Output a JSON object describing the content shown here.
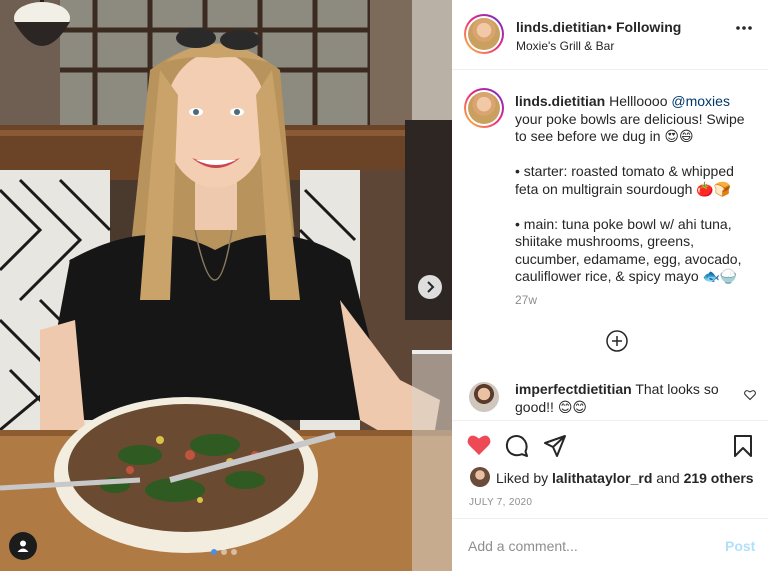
{
  "post": {
    "username": "linds.dietitian",
    "separator": "•",
    "follow_state": "Following",
    "location": "Moxie's Grill & Bar",
    "more_icon": "more-horizontal-icon"
  },
  "caption": {
    "username": "linds.dietitian",
    "intro_before_mention": "Hellloooo ",
    "mention": "@moxies",
    "intro_after_mention": " your poke bowls are delicious! Swipe to see before we dug in 😍😄",
    "starter": "• starter: roasted tomato & whipped feta on multigrain sourdough 🍅🍞",
    "main": "• main: tuna poke bowl w/ ahi tuna, shiitake mushrooms, greens, cucumber, edamame, egg, avocado, cauliflower rice, & spicy mayo 🐟🍚",
    "time_ago": "27w"
  },
  "comments": [
    {
      "username": "imperfectdietitian",
      "text": "That looks so good!! 😊😊"
    }
  ],
  "actions": {
    "liked_by_prefix": "Liked by ",
    "liked_by_user": "lalithataylor_rd",
    "liked_and": " and ",
    "others": "219 others",
    "date": "JULY 7, 2020",
    "heart_color": "#ed4956"
  },
  "add_comment": {
    "placeholder": "Add a comment...",
    "post_label": "Post"
  },
  "carousel": {
    "current": 1,
    "total": 3
  }
}
